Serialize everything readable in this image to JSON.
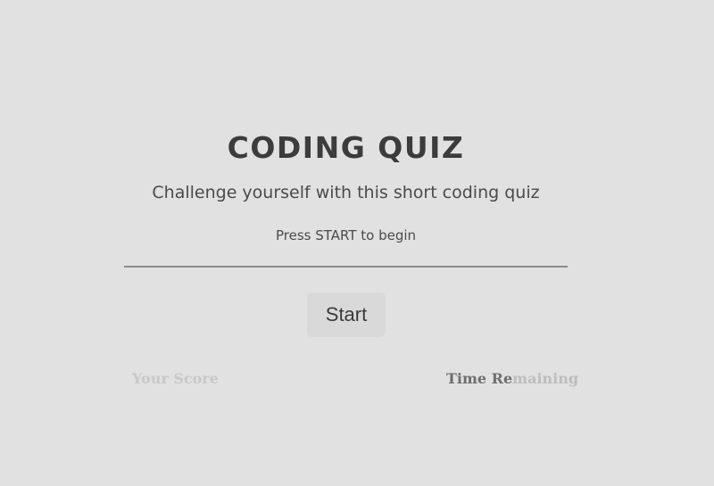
{
  "quiz": {
    "title": "CODING QUIZ",
    "subtitle": "Challenge yourself with this short coding quiz",
    "instruction": "Press START to begin",
    "start_label": "Start"
  },
  "status": {
    "score_label": "Your Score",
    "time_label_a": "Time Re",
    "time_label_b": "maining"
  }
}
